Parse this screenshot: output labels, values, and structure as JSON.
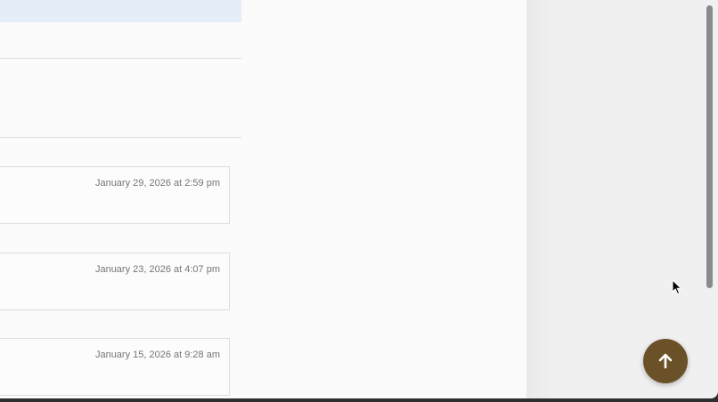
{
  "comments": [
    {
      "date": "January 29, 2026 at 2:59 pm"
    },
    {
      "date": "January 23, 2026 at 4:07 pm"
    },
    {
      "date": "January 15, 2026 at 9:28 am"
    }
  ],
  "back_to_top": {
    "icon": "arrow-up-icon",
    "color": "#6b5127"
  },
  "colors": {
    "highlight_band": "#e4edf8",
    "panel_background": "#fbfbfb",
    "page_background": "#f0f0f1"
  }
}
